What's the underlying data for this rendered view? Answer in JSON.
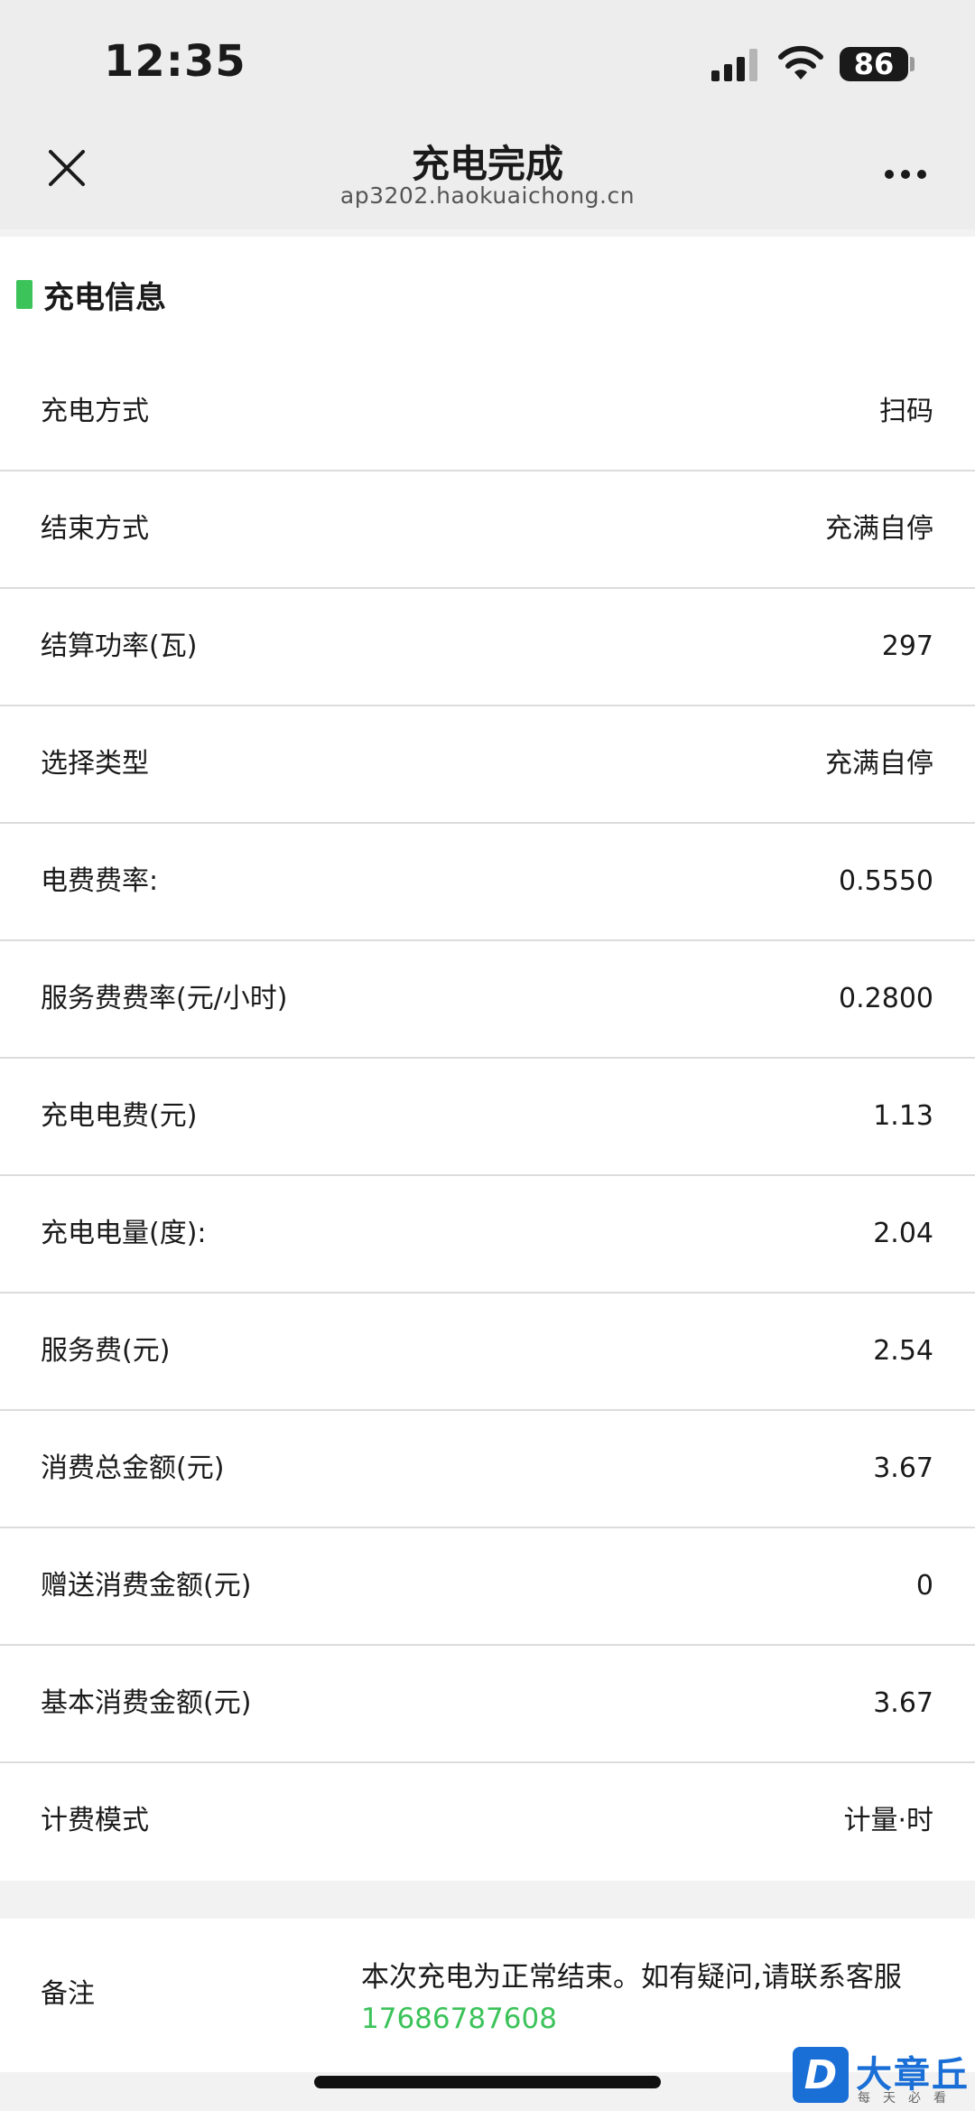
{
  "status_bar": {
    "time": "12:35",
    "battery": "86",
    "icons": [
      "signal-icon",
      "wifi-icon",
      "battery-icon"
    ]
  },
  "nav": {
    "title": "充电完成",
    "url": "ap3202.haokuaichong.cn",
    "icons": [
      "close-icon",
      "more-icon"
    ]
  },
  "section": {
    "title": "充电信息",
    "accent_color": "#3cc35a"
  },
  "rows": [
    {
      "label": "充电方式",
      "value": "扫码"
    },
    {
      "label": "结束方式",
      "value": "充满自停"
    },
    {
      "label": "结算功率(瓦)",
      "value": "297"
    },
    {
      "label": "选择类型",
      "value": "充满自停"
    },
    {
      "label": "电费费率:",
      "value": "0.5550"
    },
    {
      "label": "服务费费率(元/小时)",
      "value": "0.2800"
    },
    {
      "label": "充电电费(元)",
      "value": "1.13"
    },
    {
      "label": "充电电量(度):",
      "value": "2.04"
    },
    {
      "label": "服务费(元)",
      "value": "2.54"
    },
    {
      "label": "消费总金额(元)",
      "value": "3.67"
    },
    {
      "label": "赠送消费金额(元)",
      "value": "0"
    },
    {
      "label": "基本消费金额(元)",
      "value": "3.67"
    },
    {
      "label": "计费模式",
      "value": "计量·时"
    }
  ],
  "notes": {
    "label": "备注",
    "text": "本次充电为正常结束。如有疑问,请联系客服",
    "phone": "17686787608"
  },
  "watermark": {
    "logo_letter": "D",
    "name": "大章丘",
    "slogan": "每天必看"
  }
}
